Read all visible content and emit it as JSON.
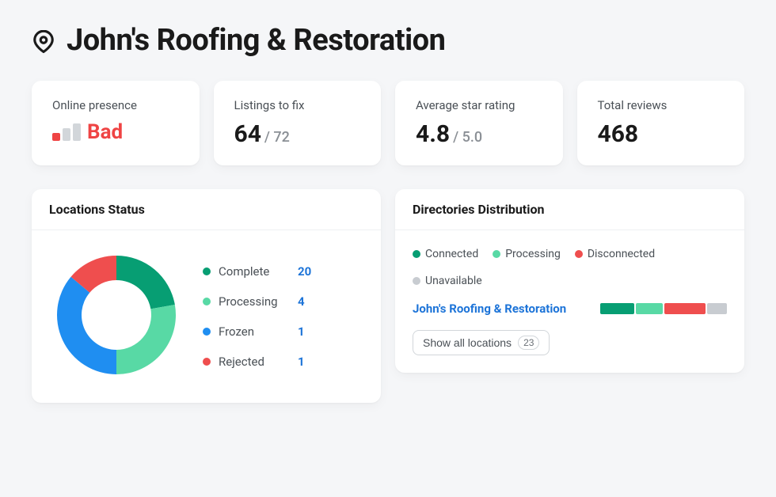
{
  "header": {
    "title": "John's Roofing & Restoration"
  },
  "stats": {
    "presence": {
      "label": "Online presence",
      "value": "Bad"
    },
    "listings": {
      "label": "Listings to fix",
      "value": "64",
      "sub": "/ 72"
    },
    "rating": {
      "label": "Average star rating",
      "value": "4.8",
      "sub": "/ 5.0"
    },
    "reviews": {
      "label": "Total reviews",
      "value": "468"
    }
  },
  "locations": {
    "title": "Locations Status",
    "items": [
      {
        "label": "Complete",
        "value": "20",
        "color": "#079e73"
      },
      {
        "label": "Processing",
        "value": "4",
        "color": "#58d9a5"
      },
      {
        "label": "Frozen",
        "value": "1",
        "color": "#1f8ef1"
      },
      {
        "label": "Rejected",
        "value": "1",
        "color": "#ef4e4e"
      }
    ]
  },
  "directories": {
    "title": "Directories Distribution",
    "legend": [
      {
        "label": "Connected",
        "color": "#079e73"
      },
      {
        "label": "Processing",
        "color": "#58d9a5"
      },
      {
        "label": "Disconnected",
        "color": "#ef4e4e"
      },
      {
        "label": "Unavailable",
        "color": "#c8ccd1"
      }
    ],
    "row_name": "John's Roofing & Restoration",
    "segments": [
      {
        "color": "#079e73",
        "flex": 28
      },
      {
        "color": "#58d9a5",
        "flex": 22
      },
      {
        "color": "#ef4e4e",
        "flex": 34
      },
      {
        "color": "#c8ccd1",
        "flex": 16
      }
    ],
    "show_all_label": "Show all locations",
    "show_all_count": "23"
  },
  "chart_data": {
    "type": "pie",
    "title": "Locations Status",
    "series": [
      {
        "name": "Complete",
        "value": 20,
        "color": "#079e73"
      },
      {
        "name": "Processing",
        "value": 4,
        "color": "#58d9a5"
      },
      {
        "name": "Frozen",
        "value": 1,
        "color": "#1f8ef1"
      },
      {
        "name": "Rejected",
        "value": 1,
        "color": "#ef4e4e"
      }
    ]
  }
}
